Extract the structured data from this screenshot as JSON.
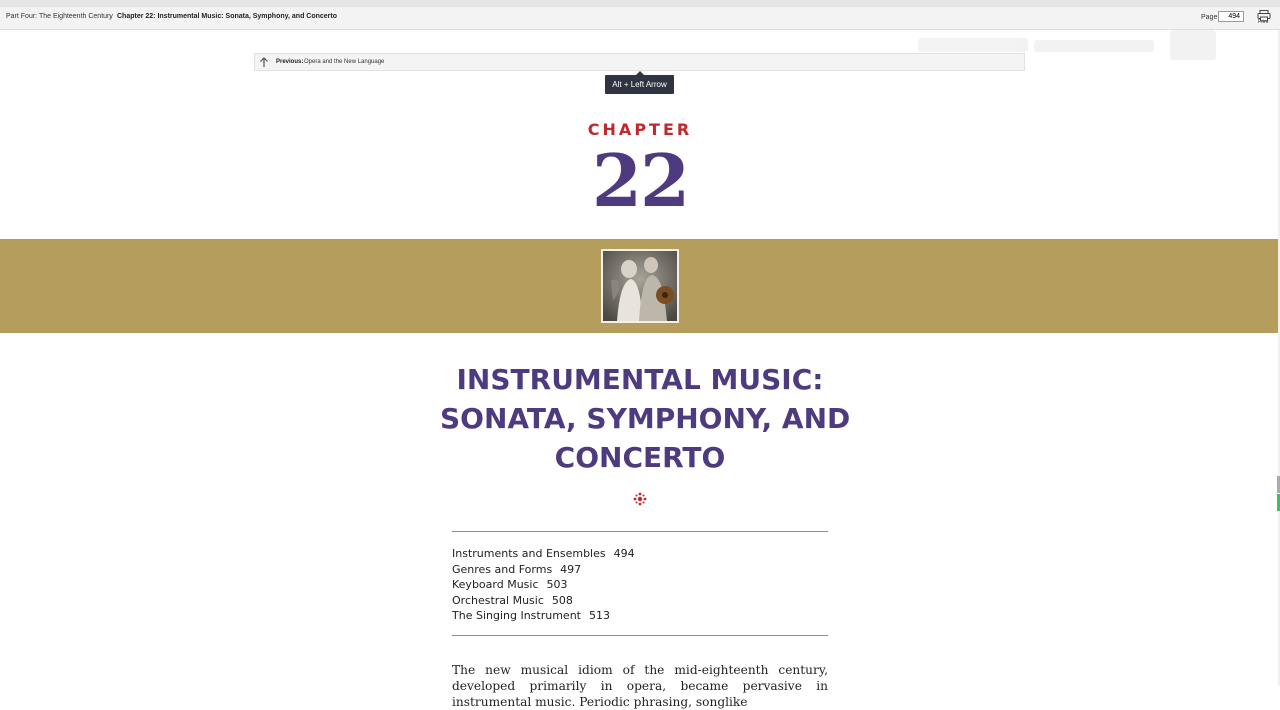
{
  "header": {
    "breadcrumb_part": "Part Four: The Eighteenth Century",
    "breadcrumb_separator": "›",
    "breadcrumb_chapter": "Chapter 22: Instrumental Music: Sonata, Symphony, and Concerto",
    "page_label": "Page",
    "page_value": "494",
    "print_label": "Print",
    "print_icon": "printer-icon"
  },
  "previous": {
    "label": "Previous:",
    "title": "Opera and the New Language",
    "icon": "arrow-up-icon"
  },
  "tooltip": {
    "text": "Alt + Left Arrow"
  },
  "chapter": {
    "word": "CHAPTER",
    "number": "22",
    "title_lines": [
      "INSTRUMENTAL MUSIC:",
      "SONATA, SYMPHONY, AND",
      "CONCERTO"
    ],
    "ornament_icon": "ornament-icon",
    "band_color": "#b59d5e",
    "title_color": "#4e3a7f",
    "chapter_word_color": "#c1282e"
  },
  "toc": [
    {
      "title": "Instruments and Ensembles",
      "page": "494"
    },
    {
      "title": "Genres and Forms",
      "page": "497"
    },
    {
      "title": "Keyboard Music",
      "page": "503"
    },
    {
      "title": "Orchestral Music",
      "page": "508"
    },
    {
      "title": "The Singing Instrument",
      "page": "513"
    }
  ],
  "body": {
    "paragraph": "The new musical idiom of the mid-eighteenth century, developed primarily in opera, became pervasive in instrumental music. Periodic phrasing, songlike"
  }
}
